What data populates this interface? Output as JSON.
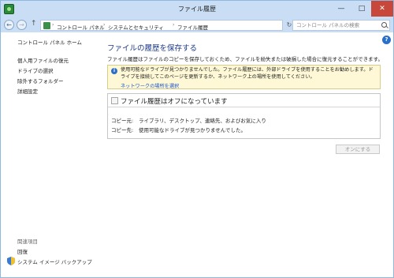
{
  "window": {
    "title": "ファイル履歴",
    "minimize": "—",
    "maximize": "□",
    "close": "✕"
  },
  "nav": {
    "back": "←",
    "forward": "→",
    "up": "↑",
    "sep": "›",
    "breadcrumbs": [
      "コントロール パネル",
      "システムとセキュリティ",
      "ファイル履歴"
    ],
    "dropdown": "⌄",
    "refresh": "↻",
    "search_placeholder": "コントロール パネルの検索"
  },
  "help": "?",
  "sidebar": {
    "home": "コントロール パネル ホーム",
    "links": [
      "個人用ファイルの復元",
      "ドライブの選択",
      "除外するフォルダー",
      "詳細設定"
    ],
    "related_heading": "関連項目",
    "related": [
      "回復",
      "システム イメージ バックアップ"
    ]
  },
  "main": {
    "title": "ファイルの履歴を保存する",
    "description": "ファイル履歴はファイルのコピーを保存しておくため、ファイルを紛失または破損した場合に復元することができます。",
    "info": {
      "icon": "i",
      "text": "使用可能なドライブが見つかりませんでした。ファイル履歴には、外部ドライブを使用することをお勧めします。ドライブを接続してこのページを更新するか、ネットワーク上の場所を使用してください。",
      "link": "ネットワークの場所を選択"
    },
    "status": {
      "title": "ファイル履歴はオフになっています",
      "copy_from_label": "コピー元:",
      "copy_from_value": "ライブラリ、デスクトップ、連絡先、およびお気に入り",
      "copy_to_label": "コピー先:",
      "copy_to_value": "使用可能なドライブが見つかりませんでした。"
    },
    "turn_on": "オンにする"
  }
}
